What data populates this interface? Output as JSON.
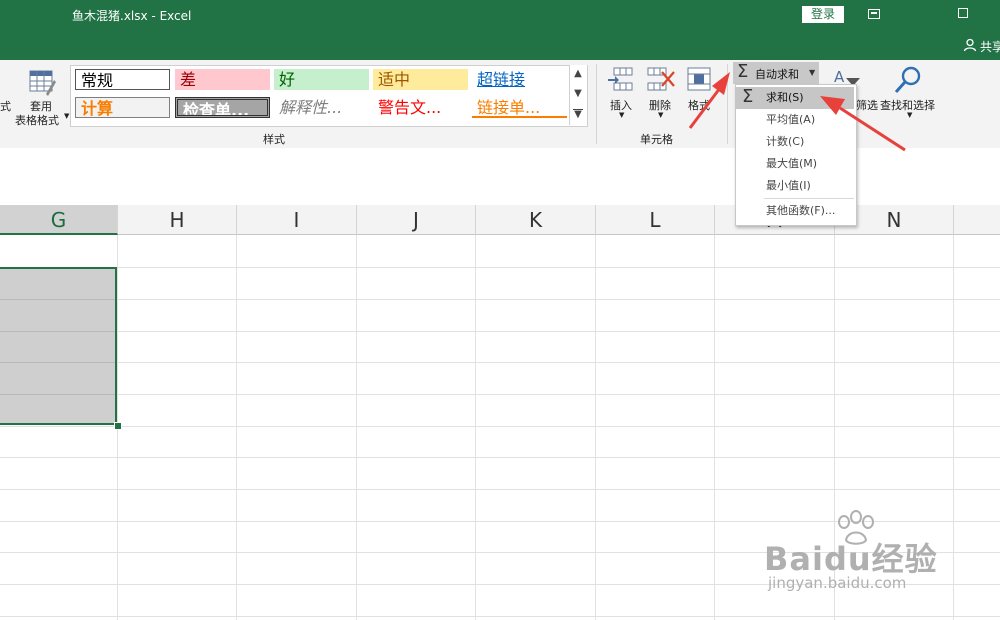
{
  "window": {
    "title": "鱼木混猪.xlsx  -  Excel",
    "login": "登录",
    "share": "共享"
  },
  "ribbon": {
    "left_partial": "式",
    "table_format": {
      "line1": "套用",
      "line2": "表格格式"
    },
    "styles_group_label": "样式",
    "styles": [
      {
        "label": "常规",
        "bg": "#ffffff",
        "fg": "#000000"
      },
      {
        "label": "差",
        "bg": "#ffc7ce",
        "fg": "#9c0006"
      },
      {
        "label": "好",
        "bg": "#c6efce",
        "fg": "#006100"
      },
      {
        "label": "适中",
        "bg": "#ffeb9c",
        "fg": "#9c5700"
      },
      {
        "label": "超链接",
        "bg": "#ffffff",
        "fg": "#0563c1"
      },
      {
        "label": "计算",
        "bg": "#f2f2f2",
        "fg": "#fa7d00"
      },
      {
        "label": "检查单...",
        "bg": "#a5a5a5",
        "fg": "#ffffff"
      },
      {
        "label": "解释性...",
        "bg": "#ffffff",
        "fg": "#7f7f7f"
      },
      {
        "label": "警告文...",
        "bg": "#ffffff",
        "fg": "#ff0000"
      },
      {
        "label": "链接单...",
        "bg": "#ffffff",
        "fg": "#fa7d00"
      }
    ],
    "cells_group_label": "单元格",
    "insert": "插入",
    "delete": "删除",
    "format_partial": "格式",
    "autosum": "自动求和",
    "filter_partial": "筛选",
    "find_select": "查找和选择"
  },
  "menu": {
    "items": [
      "求和(S)",
      "平均值(A)",
      "计数(C)",
      "最大值(M)",
      "最小值(I)",
      "其他函数(F)..."
    ]
  },
  "grid": {
    "columns": [
      "G",
      "H",
      "I",
      "J",
      "K",
      "L",
      "M",
      "N"
    ]
  },
  "watermark": {
    "brand": "Baidu经验",
    "url": "jingyan.baidu.com"
  },
  "colors": {
    "excel_green": "#217346",
    "arrow_red": "#e8413b"
  }
}
